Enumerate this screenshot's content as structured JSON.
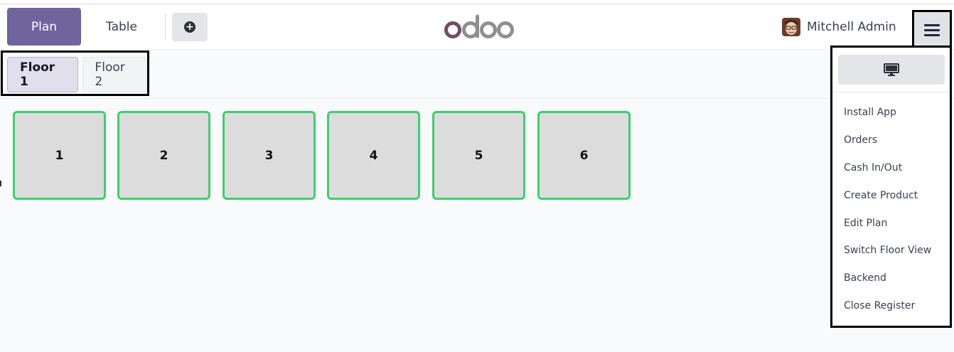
{
  "header": {
    "plan_label": "Plan",
    "table_label": "Table",
    "brand": "odoo",
    "user_name": "Mitchell Admin"
  },
  "floors": {
    "tabs": [
      {
        "label": "Floor 1",
        "active": true
      },
      {
        "label": "Floor 2",
        "active": false
      }
    ]
  },
  "tables": [
    "1",
    "2",
    "3",
    "4",
    "5",
    "6"
  ],
  "menu": {
    "items": [
      "Install App",
      "Orders",
      "Cash In/Out",
      "Create Product",
      "Edit Plan",
      "Switch Floor View",
      "Backend",
      "Close Register"
    ]
  },
  "colors": {
    "accent": "#71639e",
    "table_border": "#3ecf6e",
    "table_fill": "#dcdcdd",
    "logo": "#714b67"
  },
  "icons": {
    "add": "plus-circle-icon",
    "menu": "hamburger-menu-icon",
    "screen": "desktop-monitor-icon"
  }
}
